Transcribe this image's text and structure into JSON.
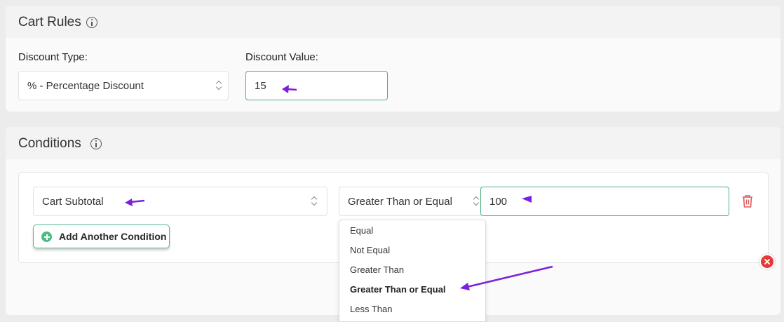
{
  "cart_rules": {
    "title": "Cart Rules",
    "discount_type_label": "Discount Type:",
    "discount_type_value": "% - Percentage Discount",
    "discount_value_label": "Discount Value:",
    "discount_value": "15"
  },
  "conditions": {
    "title": "Conditions",
    "field_value": "Cart Subtotal",
    "operator_value": "Greater Than or Equal",
    "amount_value": "100",
    "add_button_label": "Add Another Condition",
    "operator_options": [
      "Equal",
      "Not Equal",
      "Greater Than",
      "Greater Than or Equal",
      "Less Than"
    ],
    "selected_option": "Greater Than or Equal"
  },
  "colors": {
    "accent_green": "#4caf7d",
    "arrow_purple": "#7b1fe0",
    "delete_red": "#e53935"
  }
}
